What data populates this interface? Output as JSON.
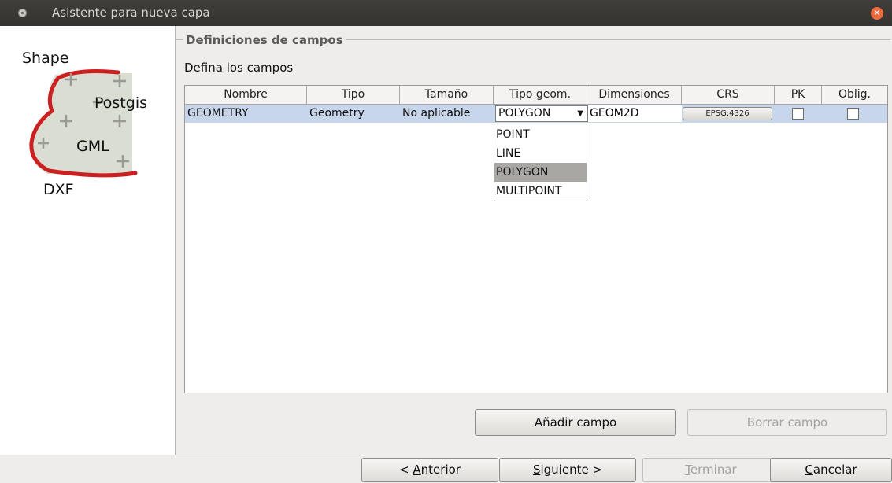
{
  "window": {
    "title": "Asistente para nueva capa"
  },
  "left_panel": {
    "labels": [
      "Shape",
      "Postgis",
      "GML",
      "DXF"
    ]
  },
  "section": {
    "title": "Definiciones de campos",
    "subtitle": "Defina los campos"
  },
  "table": {
    "columns": [
      "Nombre",
      "Tipo",
      "Tamaño",
      "Tipo geom.",
      "Dimensiones",
      "CRS",
      "PK",
      "Oblig."
    ],
    "rows": [
      {
        "nombre": "GEOMETRY",
        "tipo": "Geometry",
        "tamano": "No aplicable",
        "tipo_geom": "POLYGON",
        "dimensiones": "GEOM2D",
        "crs": "EPSG:4326",
        "pk": false,
        "oblig": false
      }
    ]
  },
  "geom_dropdown": {
    "options": [
      "POINT",
      "LINE",
      "POLYGON",
      "MULTIPOINT"
    ],
    "selected": "POLYGON"
  },
  "buttons": {
    "add_field": "Añadir campo",
    "delete_field": "Borrar campo",
    "previous_prefix": "< ",
    "previous_mnemonic": "A",
    "previous_rest": "nterior",
    "next_mnemonic": "S",
    "next_rest": "iguiente >",
    "finish_mnemonic": "T",
    "finish_rest": "erminar",
    "cancel_mnemonic": "C",
    "cancel_rest": "ancelar"
  },
  "colors": {
    "titlebar": "#3a3935",
    "close": "#ef6a3c",
    "row_selected": "#c7d6ea",
    "accent_red": "#cc1f1f"
  }
}
